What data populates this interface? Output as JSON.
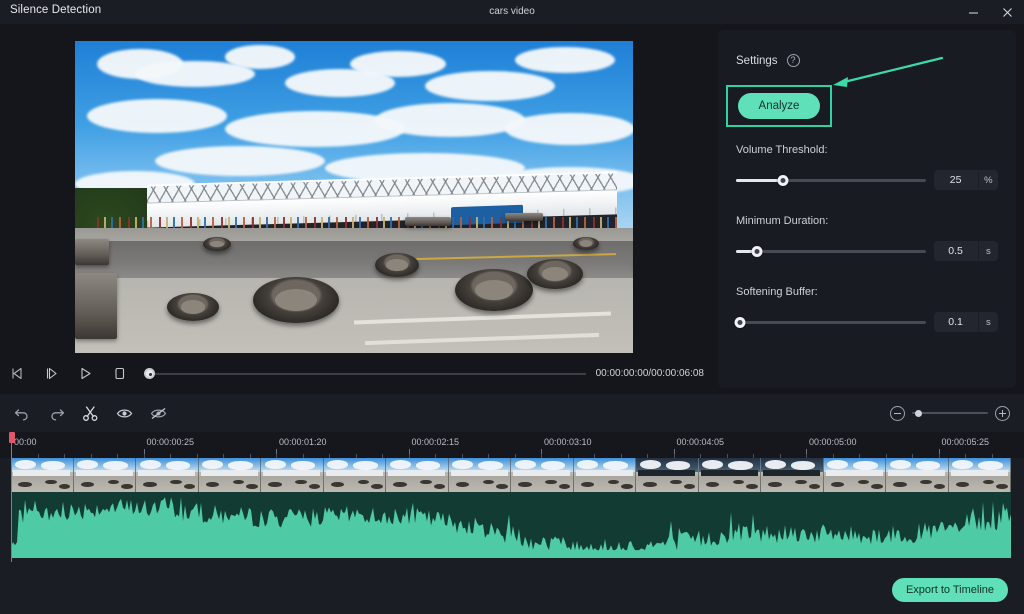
{
  "window": {
    "title": "Silence Detection",
    "document_name": "cars video",
    "minimize_label": "minimize-icon",
    "close_label": "close-icon"
  },
  "preview": {
    "scene_description": "Race track with scattered tires, grandstand and blue sky"
  },
  "transport": {
    "prev_frame": "step-backward-icon",
    "next_frame": "step-forward-icon",
    "play": "play-icon",
    "stop": "stop-icon",
    "timecode": "00:00:00:00/00:00:06:08"
  },
  "settings": {
    "title": "Settings",
    "help_icon": "?",
    "analyze_label": "Analyze",
    "controls": [
      {
        "label": "Volume Threshold:",
        "value": "25",
        "unit": "%",
        "fill_percent": 25
      },
      {
        "label": "Minimum Duration:",
        "value": "0.5",
        "unit": "s",
        "fill_percent": 11
      },
      {
        "label": "Softening Buffer:",
        "value": "0.1",
        "unit": "s",
        "fill_percent": 2
      }
    ]
  },
  "timeline": {
    "toolbar": [
      {
        "name": "undo-icon",
        "label": "Undo"
      },
      {
        "name": "redo-icon",
        "label": "Redo"
      },
      {
        "name": "scissors-icon",
        "label": "Cut"
      },
      {
        "name": "eye-icon",
        "label": "Show silences"
      },
      {
        "name": "eye-off-icon",
        "label": "Hide silences"
      }
    ],
    "zoom": {
      "minus_label": "zoom-out-icon",
      "plus_label": "zoom-in-icon",
      "level_percent": 6
    },
    "ruler_labels": [
      "00:00",
      "00:00:00:25",
      "00:00:01:20",
      "00:00:02:15",
      "00:00:03:10",
      "00:00:04:05",
      "00:00:05:00",
      "00:00:05:25"
    ],
    "playhead_position": "00:00"
  },
  "footer": {
    "export_label": "Export to Timeline"
  },
  "colors": {
    "accent": "#5fe0b8",
    "highlight_border": "#2ed2a3",
    "arrow": "#3ddaa8",
    "playhead": "#e0576a",
    "panel_bg": "#191b22",
    "window_bg": "#15161c",
    "audio_track_bg": "#123b33",
    "waveform": "#4ecaa4"
  }
}
